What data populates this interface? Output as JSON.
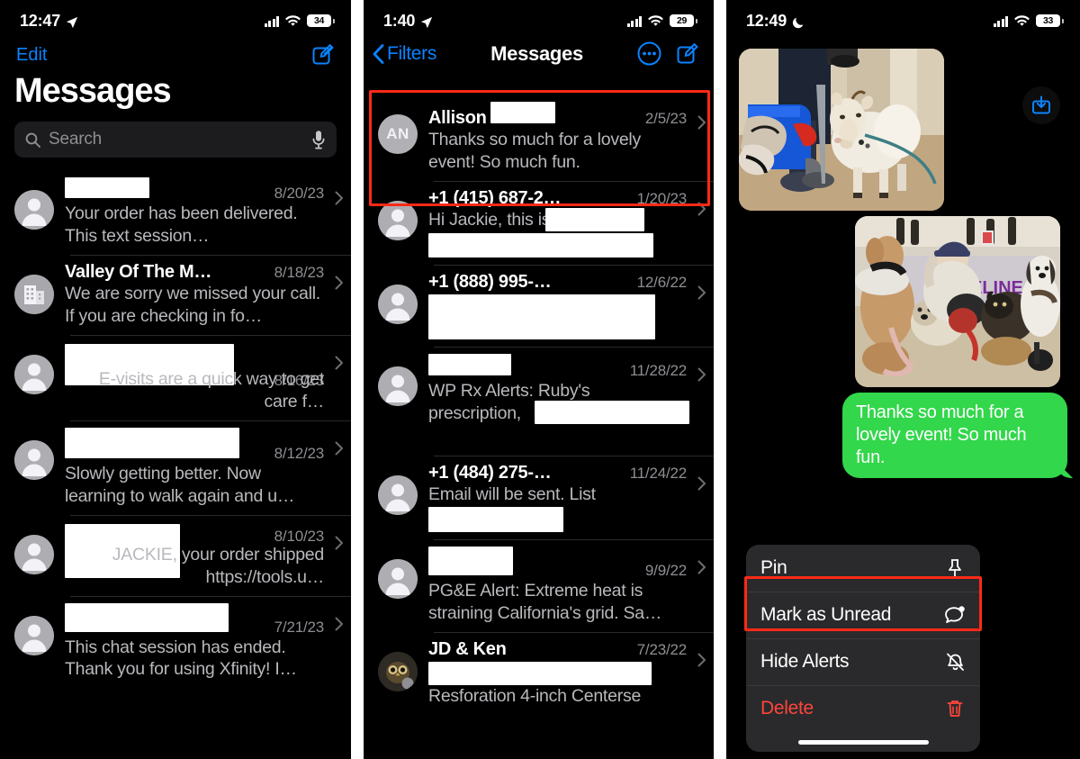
{
  "panel1": {
    "status": {
      "time": "12:47",
      "location_icon": "location-arrow-icon",
      "signal": "signal-bars-icon",
      "wifi": "wifi-icon",
      "battery": "34"
    },
    "nav": {
      "edit_label": "Edit",
      "compose_icon": "compose-icon"
    },
    "title": "Messages",
    "search": {
      "placeholder": "Search",
      "search_icon": "search-icon",
      "mic_icon": "microphone-icon"
    },
    "rows": [
      {
        "name": "",
        "name_redacted": true,
        "date": "8/20/23",
        "preview": "Your order has been delivered. This text session…",
        "avatar": "person-placeholder",
        "preview_redactions": []
      },
      {
        "name": "Valley Of The M…",
        "name_redacted": false,
        "date": "8/18/23",
        "preview": "We are sorry we missed your call. If you are checking in fo…",
        "avatar": "building-icon"
      },
      {
        "name": "",
        "name_redacted": true,
        "date": "8/16/23",
        "preview": "E-visits are a quick way to get care f…",
        "avatar": "person-placeholder"
      },
      {
        "name": "",
        "name_redacted": true,
        "date": "8/12/23",
        "preview": "Slowly getting better. Now learning to walk again and u…",
        "avatar": "person-placeholder"
      },
      {
        "name": "",
        "name_redacted": true,
        "date": "8/10/23",
        "preview": "JACKIE, your order shipped https://tools.u…",
        "avatar": "person-placeholder"
      },
      {
        "name": "",
        "name_redacted": true,
        "date": "7/21/23",
        "preview": "This chat session has ended. Thank you for using Xfinity! I…",
        "avatar": "person-placeholder"
      }
    ]
  },
  "panel2": {
    "status": {
      "time": "1:40",
      "location_icon": "location-arrow-icon",
      "battery": "29"
    },
    "nav": {
      "back_label": "Filters",
      "title": "Messages",
      "more_icon": "more-circle-icon",
      "compose_icon": "compose-icon"
    },
    "highlight_color": "#ff2a17",
    "rows": [
      {
        "name": "Allison",
        "name_redacted": true,
        "date": "2/5/23",
        "preview": "Thanks so much for a lovely event! So much fun.",
        "avatar": "AN",
        "highlighted": true
      },
      {
        "name": "+1 (415) 687-2…",
        "date": "1/20/23",
        "preview": "Hi Jackie, this is",
        "avatar": "person-placeholder"
      },
      {
        "name": "+1 (888) 995-…",
        "date": "12/6/22",
        "preview": "",
        "avatar": "person-placeholder"
      },
      {
        "name": "",
        "name_redacted": true,
        "date": "11/28/22",
        "preview": "WP Rx Alerts: Ruby's prescription,",
        "avatar": "person-placeholder"
      },
      {
        "name": "+1 (484) 275-…",
        "date": "11/24/22",
        "preview": "Email will be sent. List",
        "avatar": "person-placeholder"
      },
      {
        "name": "",
        "name_redacted": true,
        "date": "9/9/22",
        "preview": "PG&E Alert: Extreme heat is straining California's grid. Sa…",
        "avatar": "person-placeholder"
      },
      {
        "name": "JD & Ken",
        "date": "7/23/22",
        "preview": "Resforation 4-inch Centerse",
        "avatar": "owl-photo"
      }
    ]
  },
  "panel3": {
    "status": {
      "time": "12:49",
      "moon_icon": "crescent-moon-icon",
      "battery": "33"
    },
    "photos": [
      {
        "alt": "goat on leash indoors",
        "save_icon": "save-to-photos-icon"
      },
      {
        "alt": "group of dogs with person at event"
      }
    ],
    "bubble": {
      "text": "Thanks so much for a lovely event! So much fun.",
      "color": "#32d74b"
    },
    "context_menu": [
      {
        "label": "Pin",
        "icon": "pin-icon",
        "danger": false,
        "highlighted": false
      },
      {
        "label": "Mark as Unread",
        "icon": "unread-chat-bubble-icon",
        "danger": false,
        "highlighted": true
      },
      {
        "label": "Hide Alerts",
        "icon": "bell-slash-icon",
        "danger": false,
        "highlighted": false
      },
      {
        "label": "Delete",
        "icon": "trash-icon",
        "danger": true,
        "highlighted": false
      }
    ],
    "home_indicator": "home-indicator"
  }
}
